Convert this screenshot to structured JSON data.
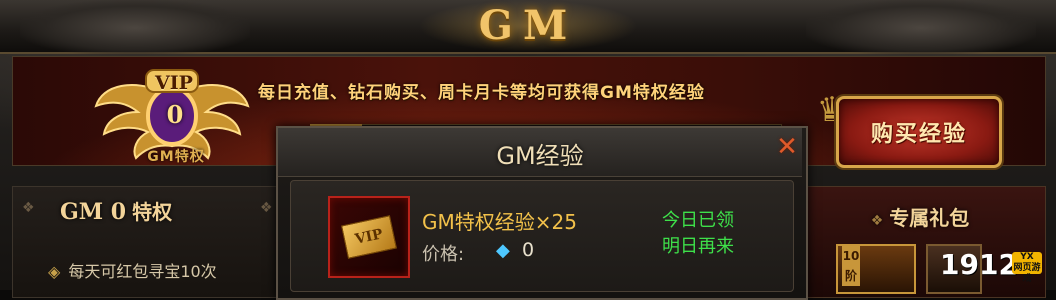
{
  "header": {
    "title": "GM"
  },
  "banner": {
    "vip_label": "VIP",
    "vip_level": "0",
    "vip_subtitle": "GM特权",
    "text": "每日充值、钻石购买、周卡月卡等均可获得GM特权经验",
    "buy_button": "购买经验"
  },
  "left_panel": {
    "title_prefix": "GM 0",
    "title_suffix": "特权",
    "items": [
      "每天可红包寻宝10次"
    ]
  },
  "right_panel": {
    "title": "专属礼包",
    "gift_tag": "10阶"
  },
  "modal": {
    "title": "GM经验",
    "close_icon": "close-x",
    "item": {
      "name": "GM特权经验×25",
      "icon_text": "VIP",
      "price_label": "价格:",
      "price_currency_icon": "diamond-icon",
      "price_value": "0",
      "status_line1": "今日已领",
      "status_line2": "明日再来"
    }
  },
  "watermark": {
    "number": "1912",
    "badge_top": "YX",
    "badge_bottom": "网页游戏"
  },
  "colors": {
    "title_gold": "#f1c46a",
    "status_green": "#3ee04a",
    "price_diamond": "#4ec8ff",
    "item_name_gold": "#f2c14a"
  }
}
